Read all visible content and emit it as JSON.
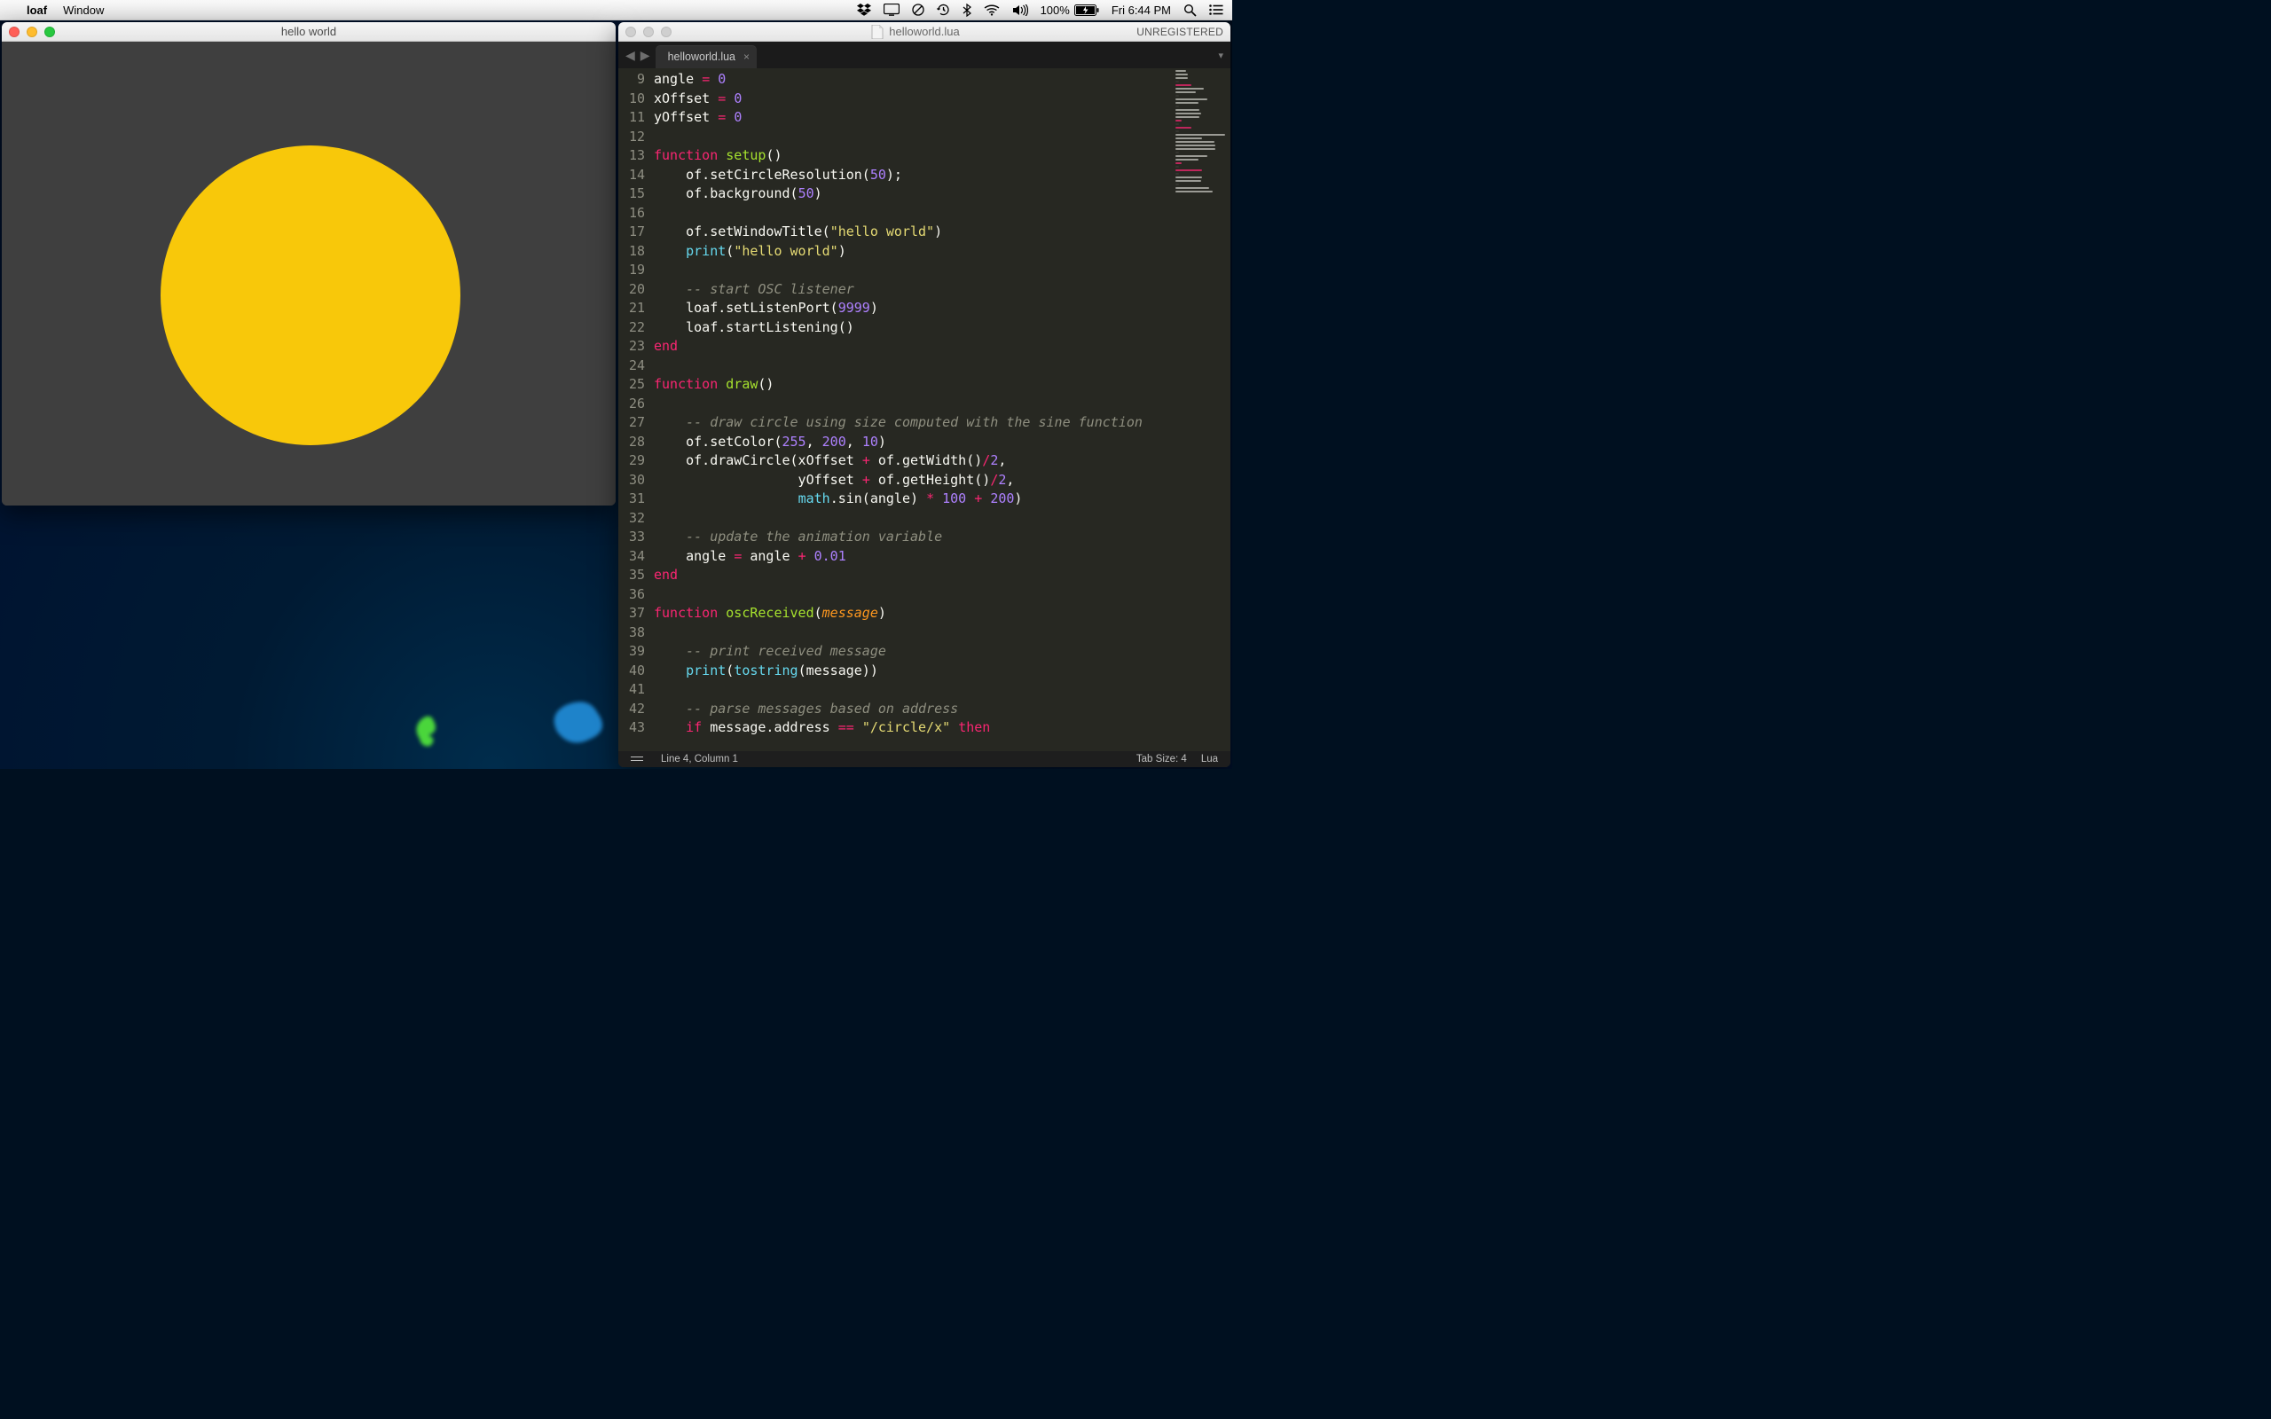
{
  "menubar": {
    "apple": "",
    "app": "loaf",
    "menus": [
      "Window"
    ],
    "battery_pct": "100%",
    "clock": "Fri 6:44 PM"
  },
  "winA": {
    "title": "hello world",
    "circle_color": "#f8c80a",
    "bg_color": "#3f3f3f"
  },
  "winB": {
    "title": "helloworld.lua",
    "unregistered": "UNREGISTERED",
    "tab": "helloworld.lua",
    "statusbar": {
      "pos": "Line 4, Column 1",
      "tabsize": "Tab Size: 4",
      "lang": "Lua"
    },
    "first_line_no": 9,
    "code_lines": [
      [
        [
          "ident",
          "angle "
        ],
        [
          "op",
          "="
        ],
        [
          "ident",
          " "
        ],
        [
          "num",
          "0"
        ]
      ],
      [
        [
          "ident",
          "xOffset "
        ],
        [
          "op",
          "="
        ],
        [
          "ident",
          " "
        ],
        [
          "num",
          "0"
        ]
      ],
      [
        [
          "ident",
          "yOffset "
        ],
        [
          "op",
          "="
        ],
        [
          "ident",
          " "
        ],
        [
          "num",
          "0"
        ]
      ],
      [],
      [
        [
          "kw",
          "function"
        ],
        [
          "ident",
          " "
        ],
        [
          "fn",
          "setup"
        ],
        [
          "ident",
          "()"
        ]
      ],
      [
        [
          "ident",
          "    of."
        ],
        [
          "ident",
          "setCircleResolution("
        ],
        [
          "num",
          "50"
        ],
        [
          "ident",
          ");"
        ]
      ],
      [
        [
          "ident",
          "    of."
        ],
        [
          "ident",
          "background("
        ],
        [
          "num",
          "50"
        ],
        [
          "ident",
          ")"
        ]
      ],
      [],
      [
        [
          "ident",
          "    of."
        ],
        [
          "ident",
          "setWindowTitle("
        ],
        [
          "str",
          "\"hello world\""
        ],
        [
          "ident",
          ")"
        ]
      ],
      [
        [
          "ident",
          "    "
        ],
        [
          "call",
          "print"
        ],
        [
          "ident",
          "("
        ],
        [
          "str",
          "\"hello world\""
        ],
        [
          "ident",
          ")"
        ]
      ],
      [],
      [
        [
          "ident",
          "    "
        ],
        [
          "cm",
          "-- start OSC listener"
        ]
      ],
      [
        [
          "ident",
          "    loaf."
        ],
        [
          "ident",
          "setListenPort("
        ],
        [
          "num",
          "9999"
        ],
        [
          "ident",
          ")"
        ]
      ],
      [
        [
          "ident",
          "    loaf."
        ],
        [
          "ident",
          "startListening()"
        ]
      ],
      [
        [
          "kw",
          "end"
        ]
      ],
      [],
      [
        [
          "kw",
          "function"
        ],
        [
          "ident",
          " "
        ],
        [
          "fn",
          "draw"
        ],
        [
          "ident",
          "()"
        ]
      ],
      [],
      [
        [
          "ident",
          "    "
        ],
        [
          "cm",
          "-- draw circle using size computed with the sine function"
        ]
      ],
      [
        [
          "ident",
          "    of."
        ],
        [
          "ident",
          "setColor("
        ],
        [
          "num",
          "255"
        ],
        [
          "ident",
          ", "
        ],
        [
          "num",
          "200"
        ],
        [
          "ident",
          ", "
        ],
        [
          "num",
          "10"
        ],
        [
          "ident",
          ")"
        ]
      ],
      [
        [
          "ident",
          "    of."
        ],
        [
          "ident",
          "drawCircle(xOffset "
        ],
        [
          "op",
          "+"
        ],
        [
          "ident",
          " of."
        ],
        [
          "ident",
          "getWidth()"
        ],
        [
          "op",
          "/"
        ],
        [
          "num",
          "2"
        ],
        [
          "ident",
          ","
        ]
      ],
      [
        [
          "ident",
          "                  yOffset "
        ],
        [
          "op",
          "+"
        ],
        [
          "ident",
          " of."
        ],
        [
          "ident",
          "getHeight()"
        ],
        [
          "op",
          "/"
        ],
        [
          "num",
          "2"
        ],
        [
          "ident",
          ","
        ]
      ],
      [
        [
          "ident",
          "                  "
        ],
        [
          "call",
          "math"
        ],
        [
          "ident",
          ".sin(angle) "
        ],
        [
          "op",
          "*"
        ],
        [
          "ident",
          " "
        ],
        [
          "num",
          "100"
        ],
        [
          "ident",
          " "
        ],
        [
          "op",
          "+"
        ],
        [
          "ident",
          " "
        ],
        [
          "num",
          "200"
        ],
        [
          "ident",
          ")"
        ]
      ],
      [],
      [
        [
          "ident",
          "    "
        ],
        [
          "cm",
          "-- update the animation variable"
        ]
      ],
      [
        [
          "ident",
          "    angle "
        ],
        [
          "op",
          "="
        ],
        [
          "ident",
          " angle "
        ],
        [
          "op",
          "+"
        ],
        [
          "ident",
          " "
        ],
        [
          "num",
          "0.01"
        ]
      ],
      [
        [
          "kw",
          "end"
        ]
      ],
      [],
      [
        [
          "kw",
          "function"
        ],
        [
          "ident",
          " "
        ],
        [
          "fn",
          "oscReceived"
        ],
        [
          "ident",
          "("
        ],
        [
          "param",
          "message"
        ],
        [
          "ident",
          ")"
        ]
      ],
      [],
      [
        [
          "ident",
          "    "
        ],
        [
          "cm",
          "-- print received message"
        ]
      ],
      [
        [
          "ident",
          "    "
        ],
        [
          "call",
          "print"
        ],
        [
          "ident",
          "("
        ],
        [
          "call",
          "tostring"
        ],
        [
          "ident",
          "(message))"
        ]
      ],
      [],
      [
        [
          "ident",
          "    "
        ],
        [
          "cm",
          "-- parse messages based on address"
        ]
      ],
      [
        [
          "ident",
          "    "
        ],
        [
          "kw",
          "if"
        ],
        [
          "ident",
          " message.address "
        ],
        [
          "op",
          "=="
        ],
        [
          "ident",
          " "
        ],
        [
          "str",
          "\"/circle/x\""
        ],
        [
          "ident",
          " "
        ],
        [
          "kw",
          "then"
        ]
      ]
    ]
  }
}
